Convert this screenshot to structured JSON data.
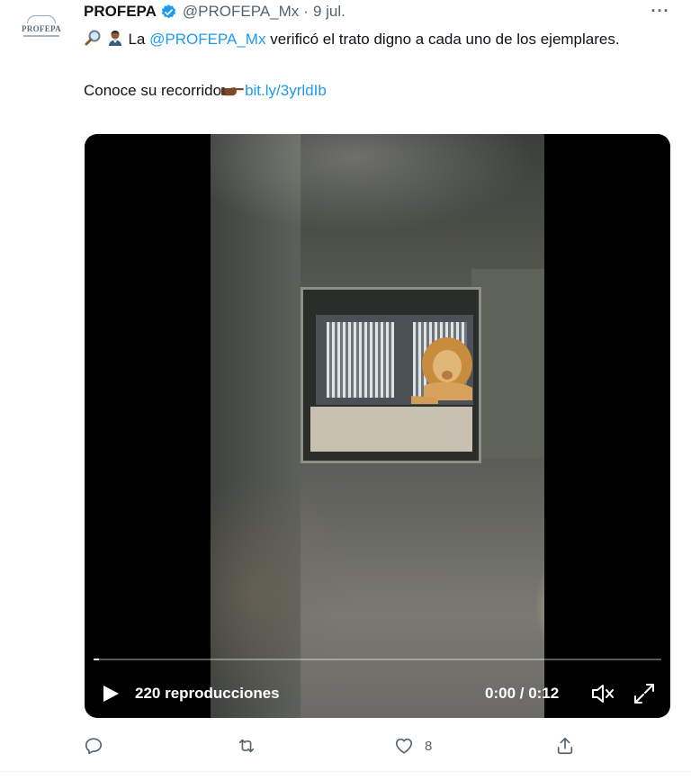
{
  "tweet": {
    "avatar_text": "PROFEPA",
    "author_name": "PROFEPA",
    "handle": "@PROFEPA_Mx",
    "separator": "·",
    "date": "9 jul.",
    "text_line1_prefix": "La ",
    "mention": "@PROFEPA_Mx",
    "text_line1_suffix": " verificó el trato digno a cada uno de los ejemplares.",
    "text_line2_prefix": "Conoce su recorrido",
    "link_text": "bit.ly/3yrldIb",
    "more_label": "···"
  },
  "video": {
    "views": "220 reproducciones",
    "time": "0:00 / 0:12",
    "progress": 0.01
  },
  "actions": {
    "reply_count": "",
    "retweet_count": "",
    "like_count": "8",
    "share_count": ""
  },
  "colors": {
    "link": "#1d9bf0",
    "secondary_text": "#536471",
    "verified": "#1d9bf0"
  }
}
